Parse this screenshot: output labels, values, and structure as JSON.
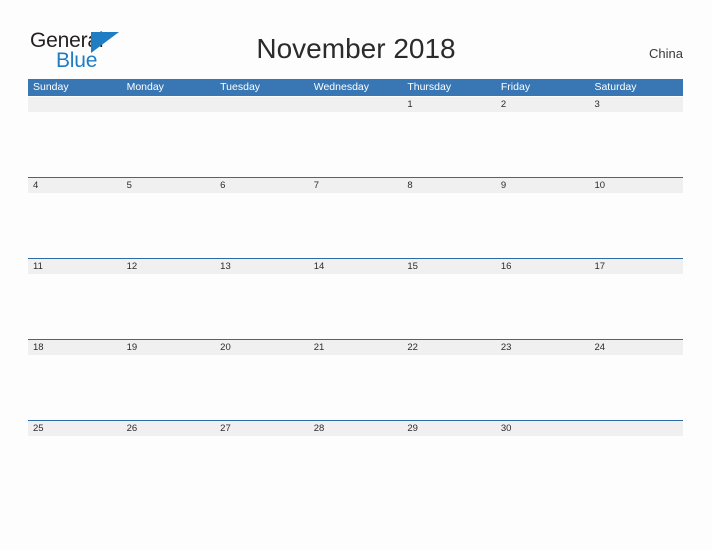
{
  "brand": {
    "word_one": "General",
    "word_two": "Blue",
    "flag_icon": "triangle-flag-icon",
    "color_dark": "#231f20",
    "color_blue": "#1f7dc4"
  },
  "header": {
    "title": "November 2018",
    "country": "China"
  },
  "theme": {
    "header_row_bg": "#3877b4",
    "header_row_text": "#ffffff",
    "week_rule": "#2d6ca8",
    "day_band_bg": "#f0f0f0",
    "page_bg": "#fdfdfd",
    "day_text": "#2b2b2b"
  },
  "calendar": {
    "month": "November",
    "year": "2018",
    "weekdays": [
      "Sunday",
      "Monday",
      "Tuesday",
      "Wednesday",
      "Thursday",
      "Friday",
      "Saturday"
    ],
    "weeks": [
      [
        "",
        "",
        "",
        "",
        "1",
        "2",
        "3"
      ],
      [
        "4",
        "5",
        "6",
        "7",
        "8",
        "9",
        "10"
      ],
      [
        "11",
        "12",
        "13",
        "14",
        "15",
        "16",
        "17"
      ],
      [
        "18",
        "19",
        "20",
        "21",
        "22",
        "23",
        "24"
      ],
      [
        "25",
        "26",
        "27",
        "28",
        "29",
        "30",
        ""
      ]
    ]
  }
}
